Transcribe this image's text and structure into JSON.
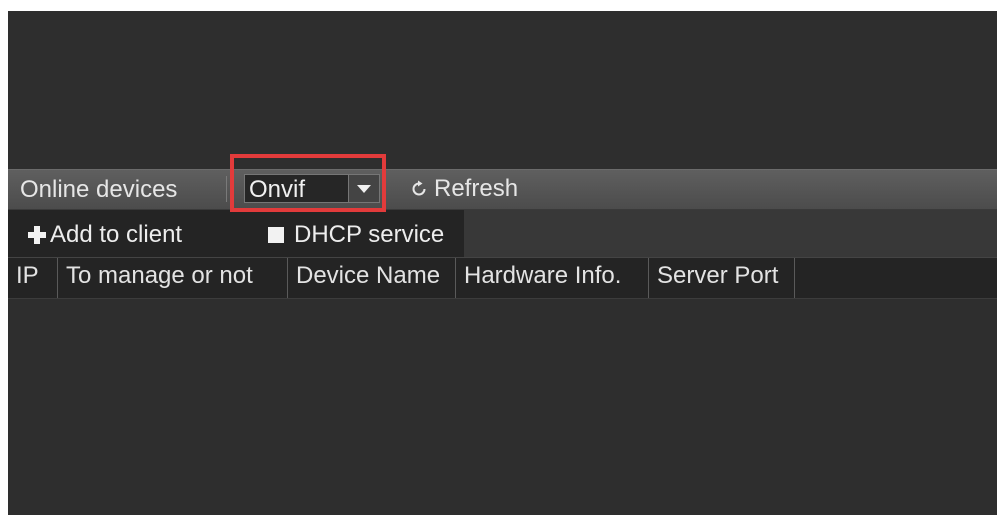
{
  "toolbar": {
    "online_label": "Online devices",
    "protocol_selected": "Onvif",
    "refresh_label": "Refresh"
  },
  "actions": {
    "add_to_client": "Add to client",
    "dhcp_service": "DHCP service"
  },
  "table": {
    "columns": [
      "IP",
      "To manage or not",
      "Device Name",
      "Hardware Info.",
      "Server Port"
    ]
  },
  "icons": {
    "refresh": "refresh-icon",
    "add": "plus-icon",
    "dropdown": "chevron-down-icon"
  },
  "colors": {
    "highlight": "#e23b3b"
  }
}
